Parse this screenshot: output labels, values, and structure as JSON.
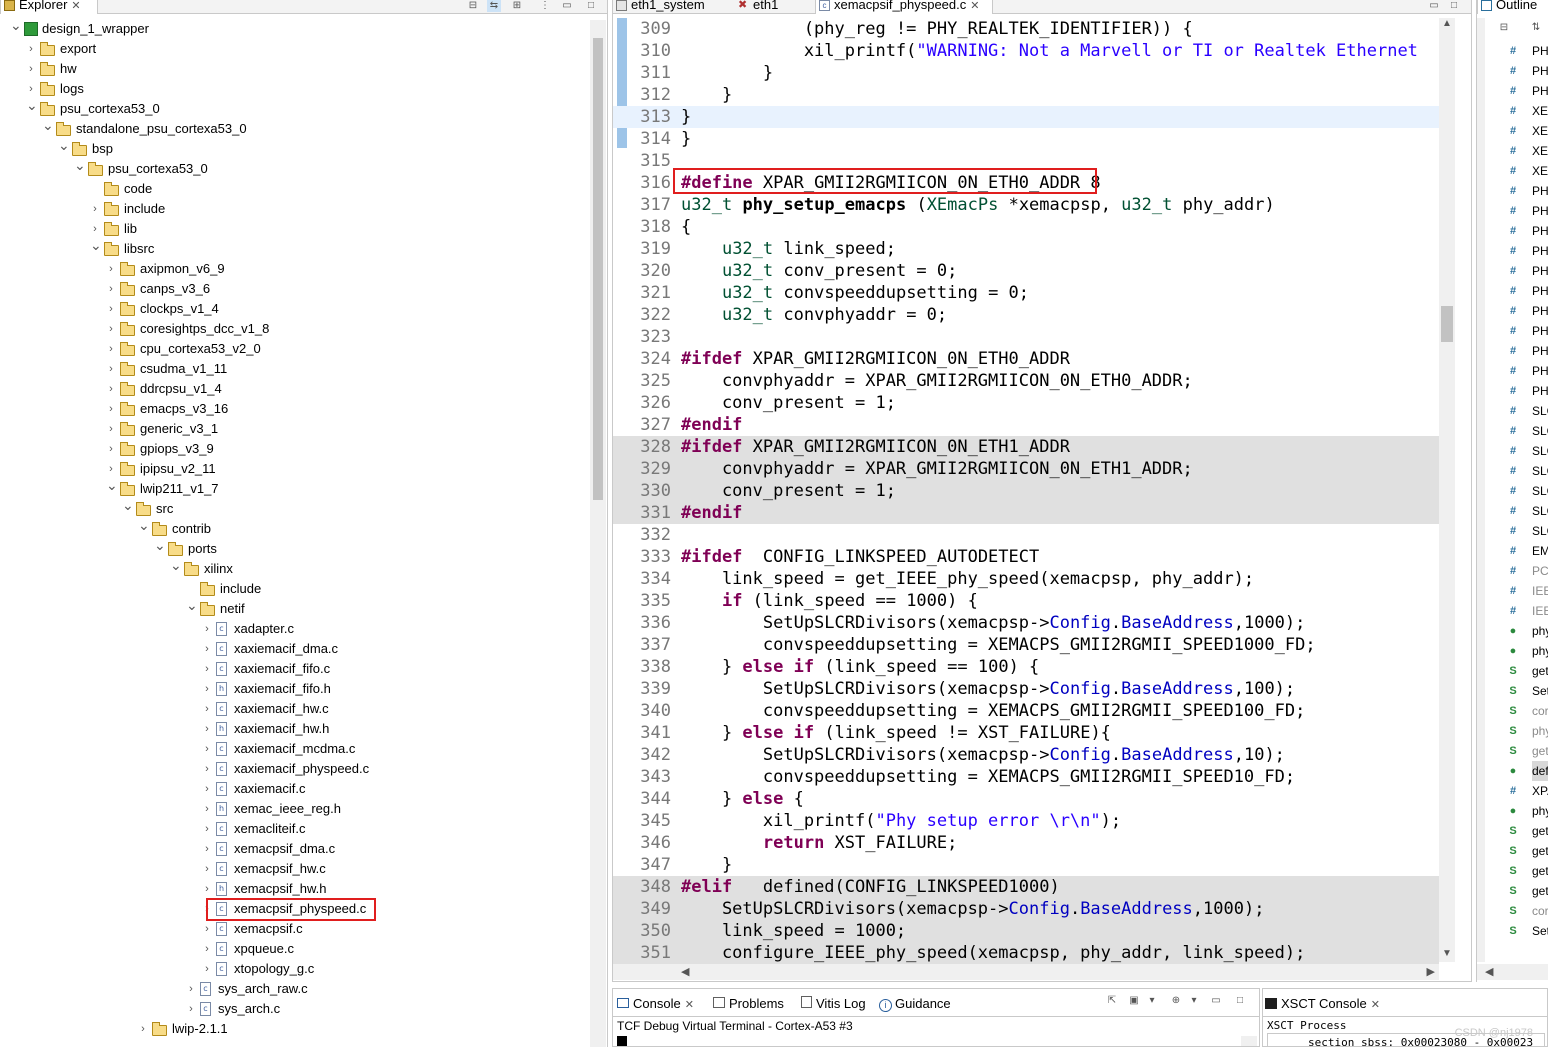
{
  "explorer": {
    "tab_label": "Explorer",
    "items": [
      {
        "label": "design_1_wrapper",
        "depth": 0,
        "chev": "v",
        "icon": "project"
      },
      {
        "label": "export",
        "depth": 1,
        "chev": ">",
        "icon": "folder"
      },
      {
        "label": "hw",
        "depth": 1,
        "chev": ">",
        "icon": "folder"
      },
      {
        "label": "logs",
        "depth": 1,
        "chev": ">",
        "icon": "folder"
      },
      {
        "label": "psu_cortexa53_0",
        "depth": 1,
        "chev": "v",
        "icon": "folder"
      },
      {
        "label": "standalone_psu_cortexa53_0",
        "depth": 2,
        "chev": "v",
        "icon": "folder"
      },
      {
        "label": "bsp",
        "depth": 3,
        "chev": "v",
        "icon": "folder"
      },
      {
        "label": "psu_cortexa53_0",
        "depth": 4,
        "chev": "v",
        "icon": "folder"
      },
      {
        "label": "code",
        "depth": 5,
        "chev": "",
        "icon": "folder"
      },
      {
        "label": "include",
        "depth": 5,
        "chev": ">",
        "icon": "folder"
      },
      {
        "label": "lib",
        "depth": 5,
        "chev": ">",
        "icon": "folder"
      },
      {
        "label": "libsrc",
        "depth": 5,
        "chev": "v",
        "icon": "folder"
      },
      {
        "label": "axipmon_v6_9",
        "depth": 6,
        "chev": ">",
        "icon": "folder"
      },
      {
        "label": "canps_v3_6",
        "depth": 6,
        "chev": ">",
        "icon": "folder"
      },
      {
        "label": "clockps_v1_4",
        "depth": 6,
        "chev": ">",
        "icon": "folder"
      },
      {
        "label": "coresightps_dcc_v1_8",
        "depth": 6,
        "chev": ">",
        "icon": "folder"
      },
      {
        "label": "cpu_cortexa53_v2_0",
        "depth": 6,
        "chev": ">",
        "icon": "folder"
      },
      {
        "label": "csudma_v1_11",
        "depth": 6,
        "chev": ">",
        "icon": "folder"
      },
      {
        "label": "ddrcpsu_v1_4",
        "depth": 6,
        "chev": ">",
        "icon": "folder"
      },
      {
        "label": "emacps_v3_16",
        "depth": 6,
        "chev": ">",
        "icon": "folder"
      },
      {
        "label": "generic_v3_1",
        "depth": 6,
        "chev": ">",
        "icon": "folder"
      },
      {
        "label": "gpiops_v3_9",
        "depth": 6,
        "chev": ">",
        "icon": "folder"
      },
      {
        "label": "ipipsu_v2_11",
        "depth": 6,
        "chev": ">",
        "icon": "folder"
      },
      {
        "label": "lwip211_v1_7",
        "depth": 6,
        "chev": "v",
        "icon": "folder"
      },
      {
        "label": "src",
        "depth": 7,
        "chev": "v",
        "icon": "folder"
      },
      {
        "label": "contrib",
        "depth": 8,
        "chev": "v",
        "icon": "folder"
      },
      {
        "label": "ports",
        "depth": 9,
        "chev": "v",
        "icon": "folder"
      },
      {
        "label": "xilinx",
        "depth": 10,
        "chev": "v",
        "icon": "folder"
      },
      {
        "label": "include",
        "depth": 11,
        "chev": "",
        "icon": "folder"
      },
      {
        "label": "netif",
        "depth": 11,
        "chev": "v",
        "icon": "folder"
      },
      {
        "label": "xadapter.c",
        "depth": 12,
        "chev": ">",
        "icon": "c"
      },
      {
        "label": "xaxiemacif_dma.c",
        "depth": 12,
        "chev": ">",
        "icon": "c"
      },
      {
        "label": "xaxiemacif_fifo.c",
        "depth": 12,
        "chev": ">",
        "icon": "c"
      },
      {
        "label": "xaxiemacif_fifo.h",
        "depth": 12,
        "chev": ">",
        "icon": "h"
      },
      {
        "label": "xaxiemacif_hw.c",
        "depth": 12,
        "chev": ">",
        "icon": "c"
      },
      {
        "label": "xaxiemacif_hw.h",
        "depth": 12,
        "chev": ">",
        "icon": "h"
      },
      {
        "label": "xaxiemacif_mcdma.c",
        "depth": 12,
        "chev": ">",
        "icon": "c"
      },
      {
        "label": "xaxiemacif_physpeed.c",
        "depth": 12,
        "chev": ">",
        "icon": "c"
      },
      {
        "label": "xaxiemacif.c",
        "depth": 12,
        "chev": ">",
        "icon": "c"
      },
      {
        "label": "xemac_ieee_reg.h",
        "depth": 12,
        "chev": ">",
        "icon": "h"
      },
      {
        "label": "xemacliteif.c",
        "depth": 12,
        "chev": ">",
        "icon": "c"
      },
      {
        "label": "xemacpsif_dma.c",
        "depth": 12,
        "chev": ">",
        "icon": "c"
      },
      {
        "label": "xemacpsif_hw.c",
        "depth": 12,
        "chev": ">",
        "icon": "c"
      },
      {
        "label": "xemacpsif_hw.h",
        "depth": 12,
        "chev": ">",
        "icon": "h"
      },
      {
        "label": "xemacpsif_physpeed.c",
        "depth": 12,
        "chev": ">",
        "icon": "c",
        "highlight": true
      },
      {
        "label": "xemacpsif.c",
        "depth": 12,
        "chev": ">",
        "icon": "c"
      },
      {
        "label": "xpqueue.c",
        "depth": 12,
        "chev": ">",
        "icon": "c"
      },
      {
        "label": "xtopology_g.c",
        "depth": 12,
        "chev": ">",
        "icon": "c"
      },
      {
        "label": "sys_arch_raw.c",
        "depth": 11,
        "chev": ">",
        "icon": "c"
      },
      {
        "label": "sys_arch.c",
        "depth": 11,
        "chev": ">",
        "icon": "c"
      },
      {
        "label": "lwip-2.1.1",
        "depth": 8,
        "chev": ">",
        "icon": "folder"
      }
    ]
  },
  "editor": {
    "tabs": [
      {
        "label": "eth1_system",
        "icon": "system"
      },
      {
        "label": "eth1",
        "icon": "tools"
      },
      {
        "label": "xemacpsif_physpeed.c",
        "icon": "c",
        "active": true
      }
    ],
    "lines": [
      {
        "n": "309",
        "t": "            (phy_reg != PHY_REALTEK_IDENTIFIER)) {"
      },
      {
        "n": "310",
        "t": "            xil_printf(\"WARNING: Not a Marvell or TI or Realtek Ethernet",
        "str": true
      },
      {
        "n": "311",
        "t": "        }"
      },
      {
        "n": "312",
        "t": "    }"
      },
      {
        "n": "313",
        "t": "}",
        "cur": true
      },
      {
        "n": "314",
        "t": "}"
      },
      {
        "n": "315",
        "t": ""
      },
      {
        "n": "316",
        "t": "#define XPAR_GMII2RGMIICON_0N_ETH0_ADDR 8",
        "box": true
      },
      {
        "n": "317",
        "t": "u32_t phy_setup_emacps (XEmacPs *xemacpsp, u32_t phy_addr)"
      },
      {
        "n": "318",
        "t": "{"
      },
      {
        "n": "319",
        "t": "    u32_t link_speed;"
      },
      {
        "n": "320",
        "t": "    u32_t conv_present = 0;"
      },
      {
        "n": "321",
        "t": "    u32_t convspeeddupsetting = 0;"
      },
      {
        "n": "322",
        "t": "    u32_t convphyaddr = 0;"
      },
      {
        "n": "323",
        "t": ""
      },
      {
        "n": "324",
        "t": "#ifdef XPAR_GMII2RGMIICON_0N_ETH0_ADDR"
      },
      {
        "n": "325",
        "t": "    convphyaddr = XPAR_GMII2RGMIICON_0N_ETH0_ADDR;"
      },
      {
        "n": "326",
        "t": "    conv_present = 1;"
      },
      {
        "n": "327",
        "t": "#endif"
      },
      {
        "n": "328",
        "t": "#ifdef XPAR_GMII2RGMIICON_0N_ETH1_ADDR",
        "gray": true
      },
      {
        "n": "329",
        "t": "    convphyaddr = XPAR_GMII2RGMIICON_0N_ETH1_ADDR;",
        "gray": true
      },
      {
        "n": "330",
        "t": "    conv_present = 1;",
        "gray": true
      },
      {
        "n": "331",
        "t": "#endif",
        "gray": true
      },
      {
        "n": "332",
        "t": ""
      },
      {
        "n": "333",
        "t": "#ifdef  CONFIG_LINKSPEED_AUTODETECT"
      },
      {
        "n": "334",
        "t": "    link_speed = get_IEEE_phy_speed(xemacpsp, phy_addr);"
      },
      {
        "n": "335",
        "t": "    if (link_speed == 1000) {"
      },
      {
        "n": "336",
        "t": "        SetUpSLCRDivisors(xemacpsp->Config.BaseAddress,1000);"
      },
      {
        "n": "337",
        "t": "        convspeeddupsetting = XEMACPS_GMII2RGMII_SPEED1000_FD;"
      },
      {
        "n": "338",
        "t": "    } else if (link_speed == 100) {"
      },
      {
        "n": "339",
        "t": "        SetUpSLCRDivisors(xemacpsp->Config.BaseAddress,100);"
      },
      {
        "n": "340",
        "t": "        convspeeddupsetting = XEMACPS_GMII2RGMII_SPEED100_FD;"
      },
      {
        "n": "341",
        "t": "    } else if (link_speed != XST_FAILURE){"
      },
      {
        "n": "342",
        "t": "        SetUpSLCRDivisors(xemacpsp->Config.BaseAddress,10);"
      },
      {
        "n": "343",
        "t": "        convspeeddupsetting = XEMACPS_GMII2RGMII_SPEED10_FD;"
      },
      {
        "n": "344",
        "t": "    } else {"
      },
      {
        "n": "345",
        "t": "        xil_printf(\"Phy setup error \\r\\n\");"
      },
      {
        "n": "346",
        "t": "        return XST_FAILURE;"
      },
      {
        "n": "347",
        "t": "    }"
      },
      {
        "n": "348",
        "t": "#elif   defined(CONFIG_LINKSPEED1000)",
        "gray": true
      },
      {
        "n": "349",
        "t": "    SetUpSLCRDivisors(xemacpsp->Config.BaseAddress,1000);",
        "gray": true
      },
      {
        "n": "350",
        "t": "    link_speed = 1000;",
        "gray": true
      },
      {
        "n": "351",
        "t": "    configure_IEEE_phy_speed(xemacpsp, phy_addr, link_speed);",
        "gray": true
      }
    ]
  },
  "outline": {
    "tab_label": "Outline",
    "items": [
      {
        "i": "#",
        "t": "PH"
      },
      {
        "i": "#",
        "t": "PH"
      },
      {
        "i": "#",
        "t": "PH"
      },
      {
        "i": "#",
        "t": "XEI"
      },
      {
        "i": "#",
        "t": "XEI"
      },
      {
        "i": "#",
        "t": "XEI"
      },
      {
        "i": "#",
        "t": "XEI"
      },
      {
        "i": "#",
        "t": "PH"
      },
      {
        "i": "#",
        "t": "PH"
      },
      {
        "i": "#",
        "t": "PH"
      },
      {
        "i": "#",
        "t": "PH"
      },
      {
        "i": "#",
        "t": "PH"
      },
      {
        "i": "#",
        "t": "PH"
      },
      {
        "i": "#",
        "t": "PH"
      },
      {
        "i": "#",
        "t": "PH"
      },
      {
        "i": "#",
        "t": "PH"
      },
      {
        "i": "#",
        "t": "PH"
      },
      {
        "i": "#",
        "t": "PH"
      },
      {
        "i": "#",
        "t": "SLC"
      },
      {
        "i": "#",
        "t": "SLC"
      },
      {
        "i": "#",
        "t": "SLC"
      },
      {
        "i": "#",
        "t": "SLC"
      },
      {
        "i": "#",
        "t": "SLC"
      },
      {
        "i": "#",
        "t": "SLC"
      },
      {
        "i": "#",
        "t": "SLC"
      },
      {
        "i": "#",
        "t": "EM"
      },
      {
        "i": "#",
        "t": "PCI",
        "dim": true
      },
      {
        "i": "#",
        "t": "IEE",
        "dim": true
      },
      {
        "i": "#",
        "t": "IEE",
        "dim": true
      },
      {
        "i": "●",
        "t": "phy"
      },
      {
        "i": "●",
        "t": "phy"
      },
      {
        "i": "S",
        "t": "get"
      },
      {
        "i": "S",
        "t": "Set"
      },
      {
        "i": "S",
        "t": "cor",
        "dim": true
      },
      {
        "i": "S",
        "t": "phy",
        "dim": true
      },
      {
        "i": "S",
        "t": "get",
        "dim": true
      },
      {
        "i": "●",
        "t": "def",
        "sel": true
      },
      {
        "i": "#",
        "t": "XPA"
      },
      {
        "i": "●",
        "t": "phy"
      },
      {
        "i": "S",
        "t": "get"
      },
      {
        "i": "S",
        "t": "get"
      },
      {
        "i": "S",
        "t": "get"
      },
      {
        "i": "S",
        "t": "get"
      },
      {
        "i": "S",
        "t": "cor",
        "dim": true
      },
      {
        "i": "S",
        "t": "Set"
      }
    ]
  },
  "console": {
    "tabs": [
      "Console",
      "Problems",
      "Vitis Log",
      "Guidance"
    ],
    "terminal": "TCF Debug Virtual Terminal - Cortex-A53 #3"
  },
  "xsct": {
    "tab_label": "XSCT Console",
    "line1": "XSCT Process",
    "line2": "section    sbss: 0x00023080 - 0x00023",
    "watermark": "CSDN @nj1978"
  }
}
